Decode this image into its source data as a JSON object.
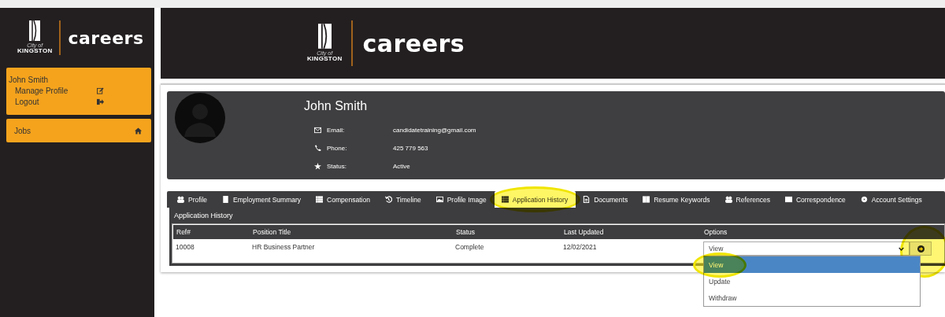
{
  "sidebar": {
    "logo": {
      "city": "City of",
      "name": "KINGSTON",
      "word": "careers"
    },
    "user": {
      "name": "John Smith",
      "links": [
        {
          "label": "Manage Profile"
        },
        {
          "label": "Logout"
        }
      ]
    },
    "nav": [
      {
        "label": "Jobs"
      }
    ]
  },
  "header": {
    "logo": {
      "city": "City of",
      "name": "KINGSTON",
      "word": "careers"
    }
  },
  "profile": {
    "name": "John Smith",
    "fields": [
      {
        "label": "Email:",
        "value": "candidatetraining@gmail.com"
      },
      {
        "label": "Phone:",
        "value": "425 779 563"
      },
      {
        "label": "Status:",
        "value": "Active"
      }
    ]
  },
  "tabs": [
    {
      "label": "Profile",
      "selected": false,
      "highlighted": false
    },
    {
      "label": "Employment Summary",
      "selected": false,
      "highlighted": false
    },
    {
      "label": "Compensation",
      "selected": false,
      "highlighted": false
    },
    {
      "label": "Timeline",
      "selected": false,
      "highlighted": false
    },
    {
      "label": "Profile Image",
      "selected": false,
      "highlighted": false
    },
    {
      "label": "Application History",
      "selected": true,
      "highlighted": true
    },
    {
      "label": "Documents",
      "selected": false,
      "highlighted": false
    },
    {
      "label": "Resume Keywords",
      "selected": false,
      "highlighted": false
    },
    {
      "label": "References",
      "selected": false,
      "highlighted": false
    },
    {
      "label": "Correspondence",
      "selected": false,
      "highlighted": false
    },
    {
      "label": "Account Settings",
      "selected": false,
      "highlighted": false
    }
  ],
  "panel": {
    "title": "Application History",
    "table": {
      "columns": [
        "Ref#",
        "Position Title",
        "Status",
        "Last Updated",
        "Options"
      ],
      "rows": [
        {
          "cells": [
            "10008",
            "HR Business Partner",
            "Complete",
            "12/02/2021"
          ],
          "select": {
            "value": "View",
            "open": true,
            "go_highlighted": true,
            "options": [
              {
                "label": "View",
                "selected": true,
                "highlighted": true
              },
              {
                "label": "Update",
                "selected": false,
                "highlighted": false
              },
              {
                "label": "Withdraw",
                "selected": false,
                "highlighted": false
              }
            ]
          }
        }
      ]
    }
  }
}
